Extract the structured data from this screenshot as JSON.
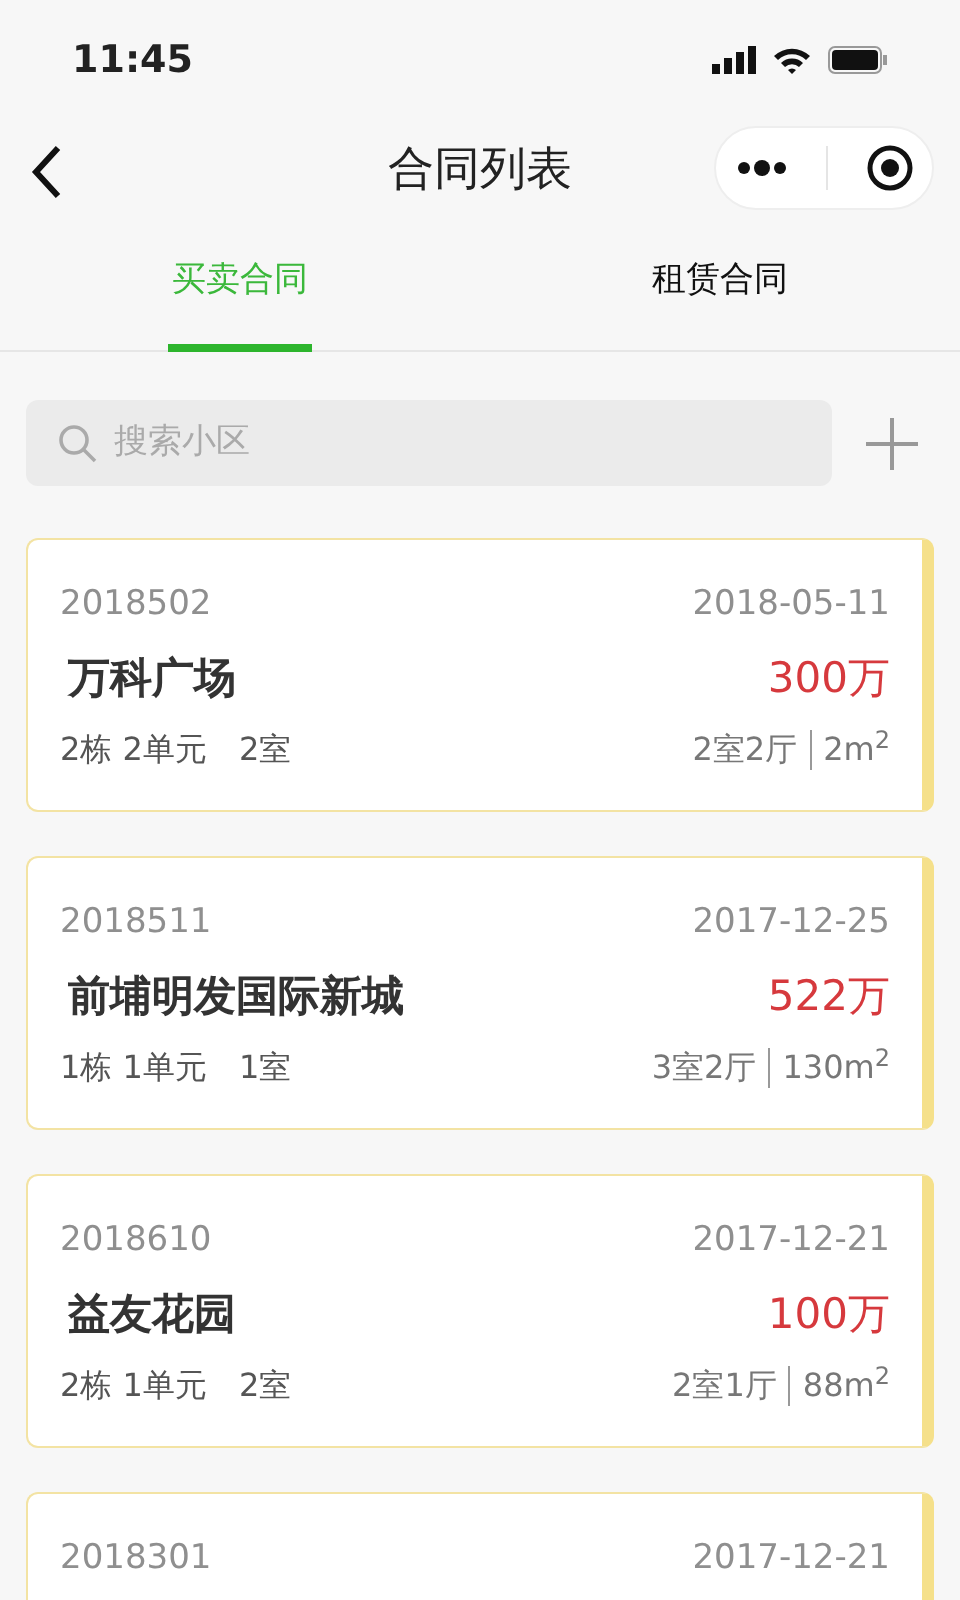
{
  "status_bar": {
    "time": "11:45"
  },
  "nav_bar": {
    "title": "合同列表"
  },
  "tabs": [
    {
      "label": "买卖合同",
      "selected": true
    },
    {
      "label": "租赁合同",
      "selected": false
    }
  ],
  "search": {
    "placeholder": "搜索小区"
  },
  "contracts": [
    {
      "number": "2018502",
      "date": "2018-05-11",
      "name": "万科广场",
      "price": "300万",
      "unit": "2栋 2单元",
      "room": "2室",
      "layout": "2室2厅",
      "area": "2m$^{2}$"
    },
    {
      "number": "2018511",
      "date": "2017-12-25",
      "name": "前埔明发国际新城",
      "price": "522万",
      "unit": "1栋 1单元",
      "room": "1室",
      "layout": "3室2厅",
      "area": "130m$^{2}$"
    },
    {
      "number": "2018610",
      "date": "2017-12-21",
      "name": "益友花园",
      "price": "100万",
      "unit": "2栋 1单元",
      "room": "2室",
      "layout": "2室1厅",
      "area": "88m$^{2}$"
    },
    {
      "number": "2018301",
      "date": "2017-12-21"
    }
  ]
}
